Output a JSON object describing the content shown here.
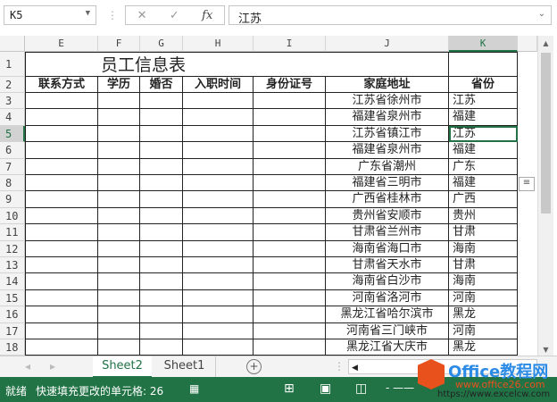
{
  "formula_bar": {
    "name_box": "K5",
    "fx": "fx",
    "cancel": "✕",
    "enter": "✓",
    "value": "江苏"
  },
  "columns": [
    "E",
    "F",
    "G",
    "H",
    "I",
    "J",
    "K"
  ],
  "selected_column": "K",
  "title": "员工信息表",
  "headers": [
    "联系方式",
    "学历",
    "婚否",
    "入职时间",
    "身份证号",
    "家庭地址",
    "省份"
  ],
  "row_numbers": [
    "1",
    "2",
    "3",
    "4",
    "5",
    "6",
    "7",
    "8",
    "9",
    "10",
    "11",
    "12",
    "13",
    "14",
    "15",
    "16",
    "17",
    "18"
  ],
  "rows": [
    {
      "address": "江苏省徐州市",
      "province": "江苏"
    },
    {
      "address": "福建省泉州市",
      "province": "福建"
    },
    {
      "address": "江苏省镇江市",
      "province": "江苏"
    },
    {
      "address": "福建省泉州市",
      "province": "福建"
    },
    {
      "address": "广东省潮州",
      "province": "广东"
    },
    {
      "address": "福建省三明市",
      "province": "福建"
    },
    {
      "address": "广西省桂林市",
      "province": "广西"
    },
    {
      "address": "贵州省安顺市",
      "province": "贵州"
    },
    {
      "address": "甘肃省兰州市",
      "province": "甘肃"
    },
    {
      "address": "海南省海口市",
      "province": "海南"
    },
    {
      "address": "甘肃省天水市",
      "province": "甘肃"
    },
    {
      "address": "海南省白沙市",
      "province": "海南"
    },
    {
      "address": "河南省洛河市",
      "province": "河南"
    },
    {
      "address": "黑龙江省哈尔滨市",
      "province": "黑龙"
    },
    {
      "address": "河南省三门峡市",
      "province": "河南"
    },
    {
      "address": "黑龙江省大庆市",
      "province": "黑龙"
    }
  ],
  "sheets": [
    "Sheet2",
    "Sheet1"
  ],
  "active_sheet": "Sheet2",
  "status": {
    "ready": "就绪",
    "flash_fill": "快速填充更改的单元格: 26"
  },
  "watermark": {
    "brand": "Office教程网",
    "url1": "www.office26.com",
    "url2": "https://www.excelcw.com"
  }
}
